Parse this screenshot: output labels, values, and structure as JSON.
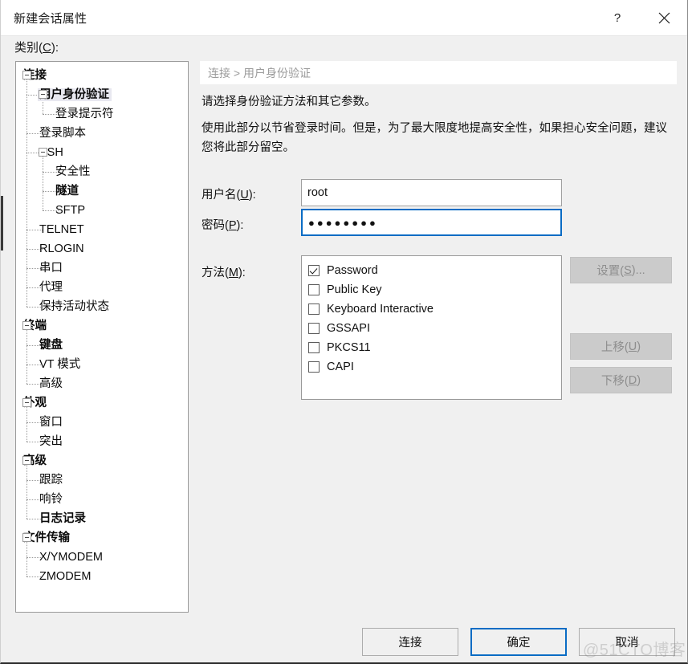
{
  "window": {
    "title": "新建会话属性",
    "help_icon": "question-mark-icon",
    "close_icon": "close-icon"
  },
  "category": {
    "label_prefix": "类别(",
    "label_accel": "C",
    "label_suffix": "):"
  },
  "tree": {
    "nodes": [
      {
        "label": "连接",
        "level": 0,
        "bold": true,
        "selected": false,
        "expander": true
      },
      {
        "label": "用户身份验证",
        "level": 1,
        "bold": true,
        "selected": true,
        "expander": true
      },
      {
        "label": "登录提示符",
        "level": 2,
        "bold": false,
        "selected": false,
        "expander": false
      },
      {
        "label": "登录脚本",
        "level": 1,
        "bold": false,
        "selected": false,
        "expander": false
      },
      {
        "label": "SSH",
        "level": 1,
        "bold": false,
        "selected": false,
        "expander": true
      },
      {
        "label": "安全性",
        "level": 2,
        "bold": false,
        "selected": false,
        "expander": false
      },
      {
        "label": "隧道",
        "level": 2,
        "bold": true,
        "selected": false,
        "expander": false
      },
      {
        "label": "SFTP",
        "level": 2,
        "bold": false,
        "selected": false,
        "expander": false
      },
      {
        "label": "TELNET",
        "level": 1,
        "bold": false,
        "selected": false,
        "expander": false
      },
      {
        "label": "RLOGIN",
        "level": 1,
        "bold": false,
        "selected": false,
        "expander": false
      },
      {
        "label": "串口",
        "level": 1,
        "bold": false,
        "selected": false,
        "expander": false
      },
      {
        "label": "代理",
        "level": 1,
        "bold": false,
        "selected": false,
        "expander": false
      },
      {
        "label": "保持活动状态",
        "level": 1,
        "bold": false,
        "selected": false,
        "expander": false
      },
      {
        "label": "终端",
        "level": 0,
        "bold": true,
        "selected": false,
        "expander": true
      },
      {
        "label": "键盘",
        "level": 1,
        "bold": true,
        "selected": false,
        "expander": false
      },
      {
        "label": "VT 模式",
        "level": 1,
        "bold": false,
        "selected": false,
        "expander": false
      },
      {
        "label": "高级",
        "level": 1,
        "bold": false,
        "selected": false,
        "expander": false
      },
      {
        "label": "外观",
        "level": 0,
        "bold": true,
        "selected": false,
        "expander": true
      },
      {
        "label": "窗口",
        "level": 1,
        "bold": false,
        "selected": false,
        "expander": false
      },
      {
        "label": "突出",
        "level": 1,
        "bold": false,
        "selected": false,
        "expander": false
      },
      {
        "label": "高级",
        "level": 0,
        "bold": true,
        "selected": false,
        "expander": true
      },
      {
        "label": "跟踪",
        "level": 1,
        "bold": false,
        "selected": false,
        "expander": false
      },
      {
        "label": "响铃",
        "level": 1,
        "bold": false,
        "selected": false,
        "expander": false
      },
      {
        "label": "日志记录",
        "level": 1,
        "bold": true,
        "selected": false,
        "expander": false
      },
      {
        "label": "文件传输",
        "level": 0,
        "bold": true,
        "selected": false,
        "expander": true
      },
      {
        "label": "X/YMODEM",
        "level": 1,
        "bold": false,
        "selected": false,
        "expander": false
      },
      {
        "label": "ZMODEM",
        "level": 1,
        "bold": false,
        "selected": false,
        "expander": false
      }
    ]
  },
  "content": {
    "breadcrumb": "连接 > 用户身份验证",
    "description_line1": "请选择身份验证方法和其它参数。",
    "description_line2": "使用此部分以节省登录时间。但是，为了最大限度地提高安全性，如果担心安全问题，建议您将此部分留空。",
    "username": {
      "label_prefix": "用户名(",
      "label_accel": "U",
      "label_suffix": "):",
      "value": "root",
      "placeholder": ""
    },
    "password": {
      "label_prefix": "密码(",
      "label_accel": "P",
      "label_suffix": "):",
      "value": "●●●●●●●●",
      "placeholder": "",
      "focused": true,
      "focus_color": "#0a6cc4"
    },
    "methods": {
      "label_prefix": "方法(",
      "label_accel": "M",
      "label_suffix": "):",
      "items": [
        {
          "label": "Password",
          "checked": true
        },
        {
          "label": "Public Key",
          "checked": false
        },
        {
          "label": "Keyboard Interactive",
          "checked": false
        },
        {
          "label": "GSSAPI",
          "checked": false
        },
        {
          "label": "PKCS11",
          "checked": false
        },
        {
          "label": "CAPI",
          "checked": false
        }
      ]
    },
    "side_buttons": [
      {
        "prefix": "设置(",
        "accel": "S",
        "suffix": ")...",
        "enabled": false
      },
      {
        "prefix": "上移(",
        "accel": "U",
        "suffix": ")",
        "enabled": false
      },
      {
        "prefix": "下移(",
        "accel": "D",
        "suffix": ")",
        "enabled": false
      }
    ]
  },
  "footer": {
    "connect_label": "连接",
    "ok_label": "确定",
    "cancel_label": "取消",
    "default_button": "确定"
  },
  "watermark": "@51CTO博客",
  "colors": {
    "accent": "#0a6cc4",
    "dialog_bg": "#f0f0f0",
    "field_bg": "#ffffff",
    "breadcrumb_text": "#9b9b9b",
    "disabled_button_bg": "#cbcbcb",
    "disabled_button_text": "#8e8e8e"
  }
}
